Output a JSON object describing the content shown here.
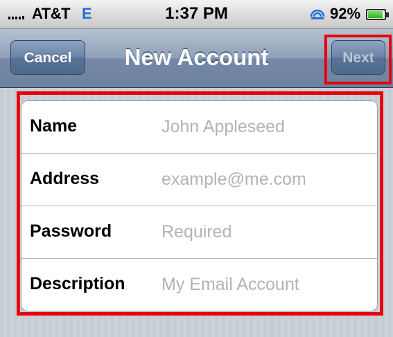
{
  "status_bar": {
    "carrier": "AT&T",
    "network": "E",
    "time": "1:37 PM",
    "battery_percent": "92%",
    "battery_level": 0.92,
    "icons": [
      "signal-bars-icon",
      "sync-icon",
      "battery-icon"
    ]
  },
  "nav": {
    "title": "New Account",
    "cancel_label": "Cancel",
    "next_label": "Next",
    "next_enabled": false
  },
  "form": {
    "fields": [
      {
        "label": "Name",
        "value": "",
        "placeholder": "John Appleseed"
      },
      {
        "label": "Address",
        "value": "",
        "placeholder": "example@me.com"
      },
      {
        "label": "Password",
        "value": "",
        "placeholder": "Required"
      },
      {
        "label": "Description",
        "value": "",
        "placeholder": "My Email Account"
      }
    ]
  },
  "colors": {
    "highlight": "#e8000b",
    "nav_bar": "#6d829f",
    "network_indicator": "#1f6fd6",
    "battery": "#2fb31f",
    "placeholder_text": "#b3b3b3"
  }
}
